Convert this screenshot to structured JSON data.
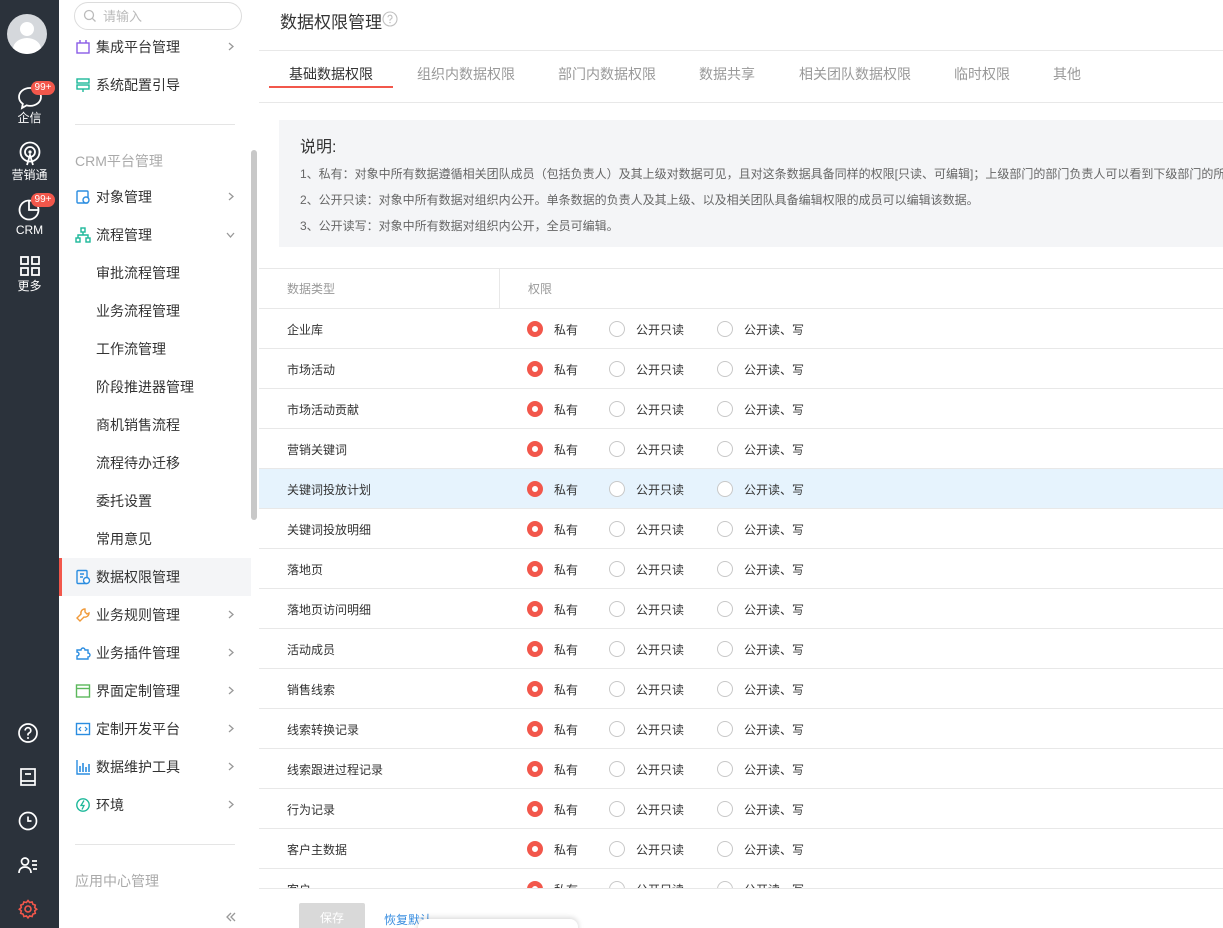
{
  "rail": {
    "items": [
      {
        "label": "企信",
        "badge": "99+"
      },
      {
        "label": "营销通"
      },
      {
        "label": "CRM",
        "badge": "99+"
      },
      {
        "label": "更多"
      }
    ]
  },
  "sidebar": {
    "search_placeholder": "请输入",
    "top_items": [
      {
        "label": "集成平台管理"
      },
      {
        "label": "系统配置引导"
      }
    ],
    "section_crm": "CRM平台管理",
    "items": [
      {
        "label": "对象管理"
      },
      {
        "label": "流程管理"
      }
    ],
    "sub_items": [
      "审批流程管理",
      "业务流程管理",
      "工作流管理",
      "阶段推进器管理",
      "商机销售流程",
      "流程待办迁移",
      "委托设置",
      "常用意见"
    ],
    "more_items": [
      {
        "label": "数据权限管理"
      },
      {
        "label": "业务规则管理"
      },
      {
        "label": "业务插件管理"
      },
      {
        "label": "界面定制管理"
      },
      {
        "label": "定制开发平台"
      },
      {
        "label": "数据维护工具"
      },
      {
        "label": "环境"
      }
    ],
    "section_app": "应用中心管理"
  },
  "main": {
    "title": "数据权限管理",
    "tabs": [
      "基础数据权限",
      "组织内数据权限",
      "部门内数据权限",
      "数据共享",
      "相关团队数据权限",
      "临时权限",
      "其他"
    ],
    "note": {
      "title": "说明:",
      "lines": [
        "1、私有：对象中所有数据遵循相关团队成员（包括负责人）及其上级对数据可见，且对这条数据具备同样的权限[只读、可编辑]；上级部门的部门负责人可以看到下级部门的所",
        "2、公开只读：对象中所有数据对组织内公开。单条数据的负责人及其上级、以及相关团队具备编辑权限的成员可以编辑该数据。",
        "3、公开读写：对象中所有数据对组织内公开，全员可编辑。"
      ]
    },
    "table": {
      "col_type": "数据类型",
      "col_perm": "权限",
      "options": [
        "私有",
        "公开只读",
        "公开读、写"
      ],
      "rows": [
        {
          "name": "企业库",
          "selected": 0
        },
        {
          "name": "市场活动",
          "selected": 0
        },
        {
          "name": "市场活动贡献",
          "selected": 0
        },
        {
          "name": "营销关键词",
          "selected": 0
        },
        {
          "name": "关键词投放计划",
          "selected": 0
        },
        {
          "name": "关键词投放明细",
          "selected": 0
        },
        {
          "name": "落地页",
          "selected": 0
        },
        {
          "name": "落地页访问明细",
          "selected": 0
        },
        {
          "name": "活动成员",
          "selected": 0
        },
        {
          "name": "销售线索",
          "selected": 0
        },
        {
          "name": "线索转换记录",
          "selected": 0
        },
        {
          "name": "线索跟进过程记录",
          "selected": 0
        },
        {
          "name": "行为记录",
          "selected": 0
        },
        {
          "name": "客户主数据",
          "selected": 0
        },
        {
          "name": "客户",
          "selected": 0
        }
      ]
    },
    "footer": {
      "save": "保存",
      "restore": "恢复默认"
    }
  },
  "colors": {
    "accent": "#f2574b",
    "rail_bg": "#2b323b",
    "link": "#3b8fe0",
    "hover_row": "#e6f3fd"
  }
}
